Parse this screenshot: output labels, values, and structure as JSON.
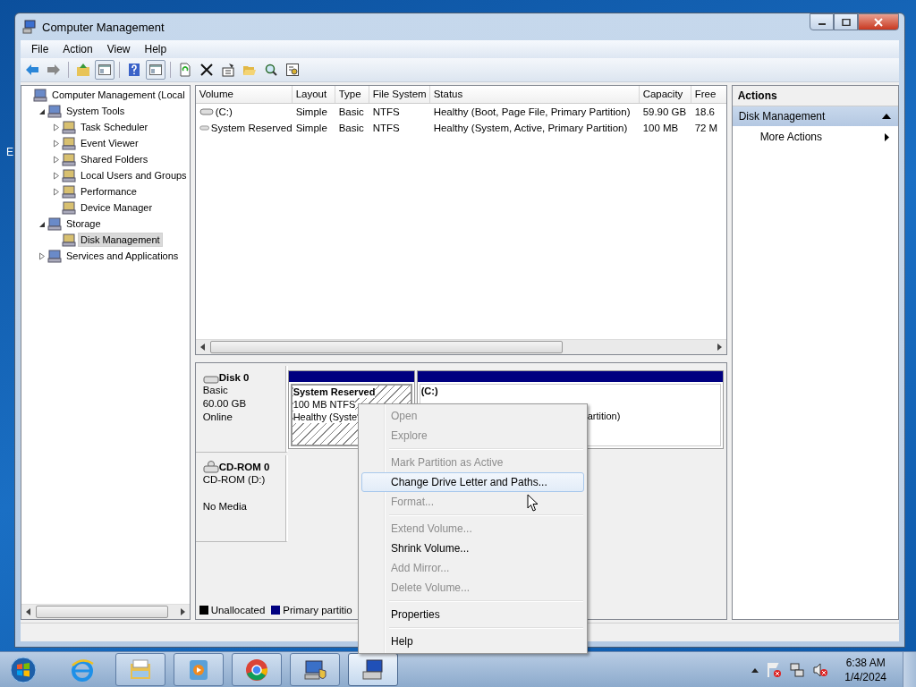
{
  "desktop": {
    "label": "E"
  },
  "window": {
    "title": "Computer Management"
  },
  "menu_bar": [
    "File",
    "Action",
    "View",
    "Help"
  ],
  "tree": [
    {
      "label": "Computer Management (Local",
      "selected": false,
      "children": [
        {
          "label": "System Tools",
          "expanded": true,
          "selected": false,
          "children": [
            {
              "label": "Task Scheduler",
              "expanded": false,
              "selected": false
            },
            {
              "label": "Event Viewer",
              "expanded": false,
              "selected": false
            },
            {
              "label": "Shared Folders",
              "expanded": false,
              "selected": false
            },
            {
              "label": "Local Users and Groups",
              "expanded": false,
              "selected": false
            },
            {
              "label": "Performance",
              "expanded": false,
              "selected": false
            },
            {
              "label": "Device Manager",
              "selected": false
            }
          ]
        },
        {
          "label": "Storage",
          "expanded": true,
          "selected": false,
          "children": [
            {
              "label": "Disk Management",
              "selected": true
            }
          ]
        },
        {
          "label": "Services and Applications",
          "expanded": false,
          "selected": false
        }
      ]
    }
  ],
  "volumes": {
    "columns": [
      "Volume",
      "Layout",
      "Type",
      "File System",
      "Status",
      "Capacity",
      "Free"
    ],
    "rows": [
      {
        "cells": [
          "(C:)",
          "Simple",
          "Basic",
          "NTFS",
          "Healthy (Boot, Page File, Primary Partition)",
          "59.90 GB",
          "18.6"
        ]
      },
      {
        "cells": [
          "System Reserved",
          "Simple",
          "Basic",
          "NTFS",
          "Healthy (System, Active, Primary Partition)",
          "100 MB",
          "72 M"
        ]
      }
    ]
  },
  "disks": [
    {
      "kind": "disk",
      "name": "Disk 0",
      "lines": [
        "Basic",
        "60.00 GB",
        "Online"
      ],
      "partitions": [
        {
          "name": "System Reserved",
          "lines": [
            "100 MB NTFS",
            "Healthy (Syste"
          ],
          "selected": true
        },
        {
          "name": "(C:)",
          "lines": [
            "artition)"
          ],
          "selected": false
        }
      ]
    },
    {
      "kind": "cdrom",
      "name": "CD-ROM 0",
      "lines": [
        "CD-ROM (D:)",
        "No Media"
      ]
    }
  ],
  "legend": [
    {
      "label": "Unallocated",
      "color": "#000000"
    },
    {
      "label": "Primary partitio",
      "color": "#000080"
    }
  ],
  "actions": {
    "title": "Actions",
    "section": {
      "label": "Disk Management",
      "expanded": true
    },
    "items": [
      {
        "label": "More Actions"
      }
    ]
  },
  "context_menu": [
    {
      "kind": "item",
      "label": "Open",
      "disabled": true,
      "selected": false
    },
    {
      "kind": "item",
      "label": "Explore",
      "disabled": true,
      "selected": false
    },
    {
      "kind": "separator"
    },
    {
      "kind": "item",
      "label": "Mark Partition as Active",
      "disabled": true,
      "selected": false
    },
    {
      "kind": "item",
      "label": "Change Drive Letter and Paths...",
      "disabled": false,
      "selected": true
    },
    {
      "kind": "item",
      "label": "Format...",
      "disabled": true,
      "selected": false
    },
    {
      "kind": "separator"
    },
    {
      "kind": "item",
      "label": "Extend Volume...",
      "disabled": true,
      "selected": false
    },
    {
      "kind": "item",
      "label": "Shrink Volume...",
      "disabled": false,
      "selected": false
    },
    {
      "kind": "item",
      "label": "Add Mirror...",
      "disabled": true,
      "selected": false
    },
    {
      "kind": "item",
      "label": "Delete Volume...",
      "disabled": true,
      "selected": false
    },
    {
      "kind": "separator"
    },
    {
      "kind": "item",
      "label": "Properties",
      "disabled": false,
      "selected": false
    },
    {
      "kind": "separator"
    },
    {
      "kind": "item",
      "label": "Help",
      "disabled": false,
      "selected": false
    }
  ],
  "taskbar": {
    "apps": [
      {
        "running": false,
        "active": false
      },
      {
        "running": true,
        "active": false
      },
      {
        "running": true,
        "active": false
      },
      {
        "running": true,
        "active": false
      },
      {
        "running": true,
        "active": false
      },
      {
        "running": true,
        "active": true
      }
    ],
    "time": "6:38 AM",
    "date": "1/4/2024"
  }
}
